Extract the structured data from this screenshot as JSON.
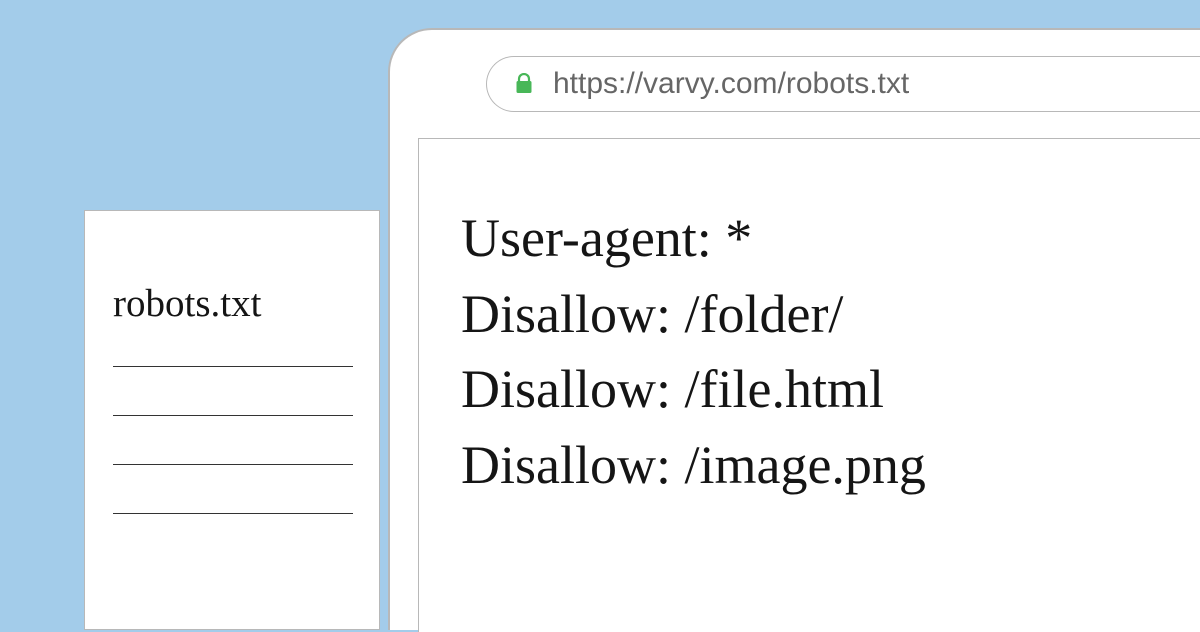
{
  "document": {
    "title": "robots.txt"
  },
  "browser": {
    "url": "https://varvy.com/robots.txt",
    "content": {
      "line1": "User-agent: *",
      "line2": "Disallow: /folder/",
      "line3": "Disallow: /file.html",
      "line4": "Disallow: /image.png"
    }
  }
}
